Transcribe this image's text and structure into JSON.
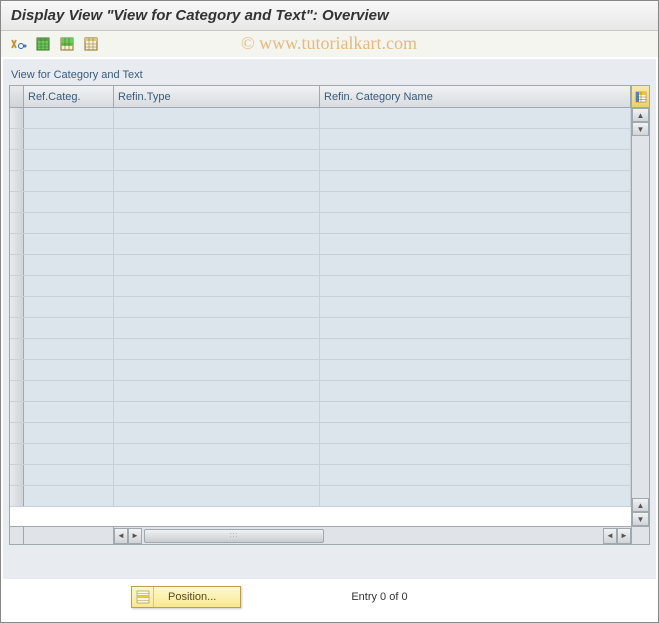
{
  "header": {
    "title": "Display View \"View for Category and Text\": Overview"
  },
  "watermark": "© www.tutorialkart.com",
  "panel": {
    "title": "View for Category and Text"
  },
  "columns": {
    "refcateg": "Ref.Categ.",
    "refintype": "Refin.Type",
    "refincatname": "Refin. Category Name"
  },
  "footer": {
    "position_label": "Position...",
    "entry_text": "Entry 0 of 0"
  },
  "icons": {
    "toggle": "toggle-icon",
    "select_all": "select-all-icon",
    "select_block": "select-block-icon",
    "deselect_all": "deselect-all-icon",
    "settings": "table-settings-icon",
    "position": "position-icon"
  }
}
